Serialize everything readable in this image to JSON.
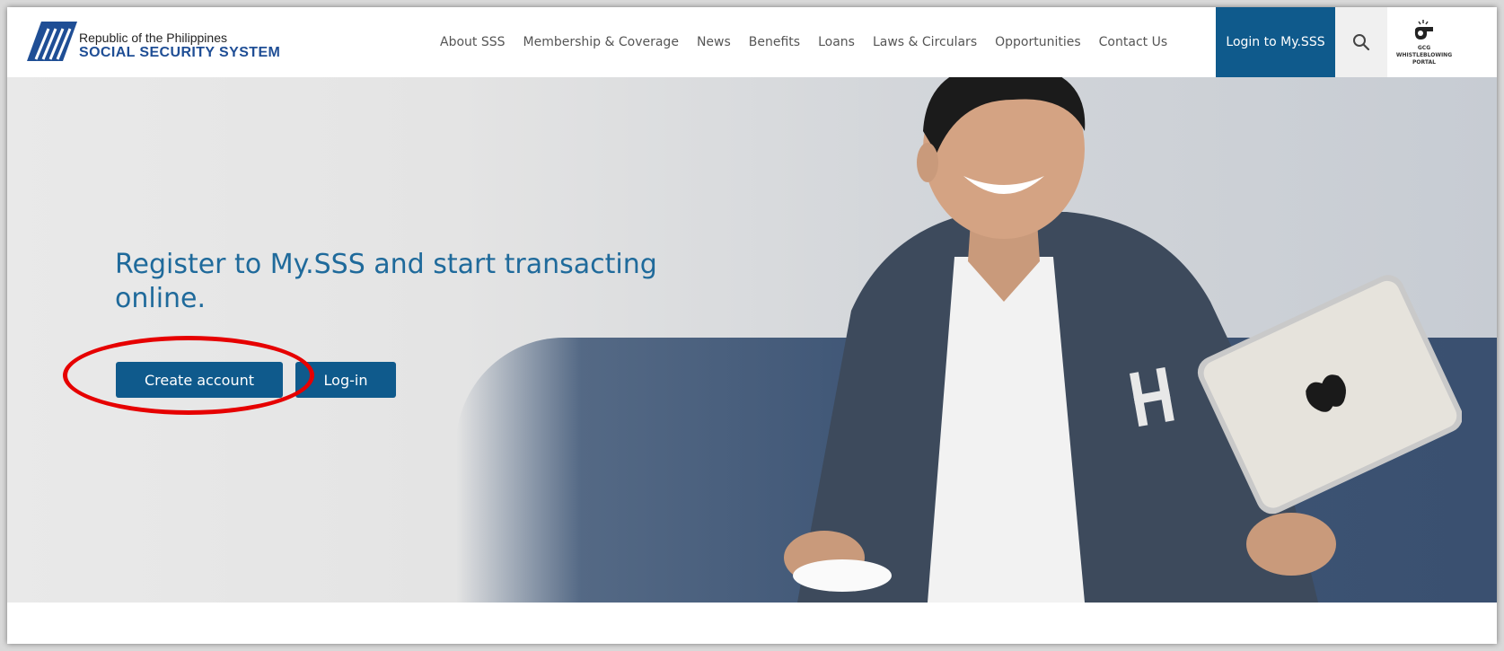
{
  "header": {
    "logo": {
      "line1": "Republic of the Philippines",
      "line2": "SOCIAL SECURITY SYSTEM"
    },
    "nav": [
      {
        "label": "About SSS"
      },
      {
        "label": "Membership & Coverage"
      },
      {
        "label": "News"
      },
      {
        "label": "Benefits"
      },
      {
        "label": "Loans"
      },
      {
        "label": "Laws & Circulars"
      },
      {
        "label": "Opportunities"
      },
      {
        "label": "Contact Us"
      }
    ],
    "login_label": "Login to My.SSS",
    "search_icon": "search-icon",
    "whistleblowing": {
      "line1": "GCG",
      "line2": "WHISTLEBLOWING",
      "line3": "PORTAL"
    }
  },
  "hero": {
    "title": "Register to My.SSS and start transacting online.",
    "create_account_label": "Create account",
    "login_label": "Log-in"
  },
  "colors": {
    "brand_blue": "#0f5a8c",
    "title_blue": "#1f6a9b",
    "annotation_red": "#e60000"
  }
}
